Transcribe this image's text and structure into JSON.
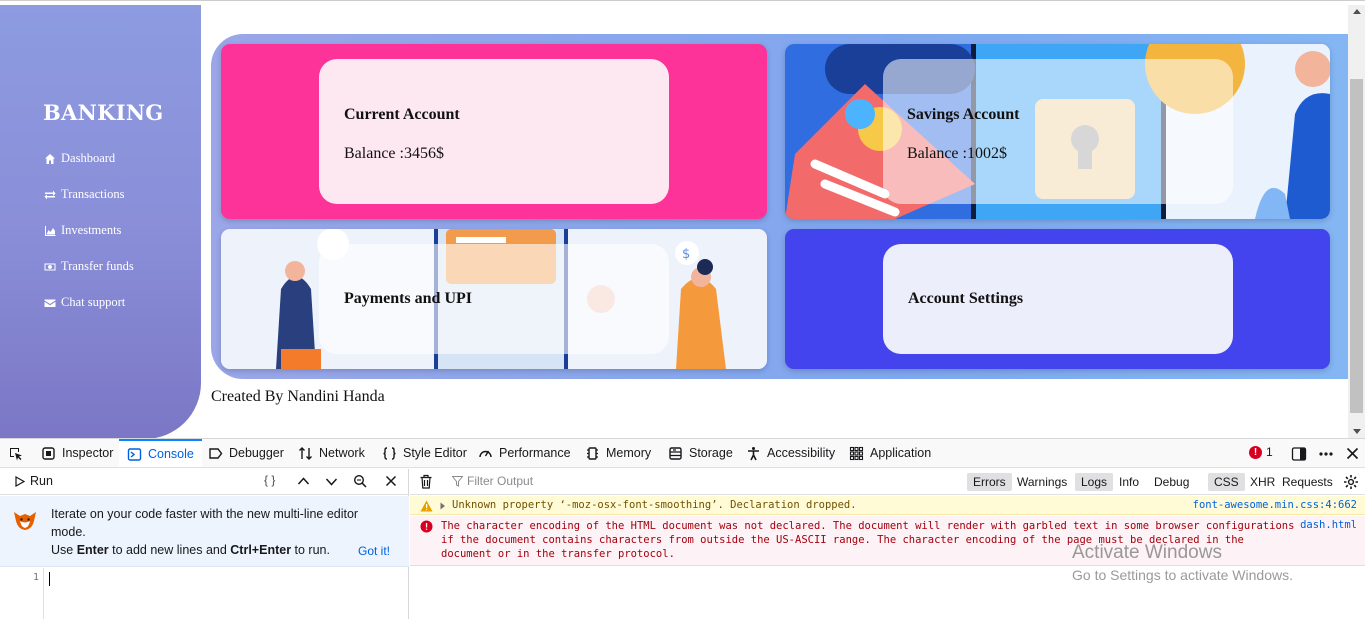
{
  "app": {
    "brand": "BANKING",
    "nav": [
      {
        "label": "Dashboard",
        "icon": "home-icon"
      },
      {
        "label": "Transactions",
        "icon": "exchange-icon"
      },
      {
        "label": "Investments",
        "icon": "area-chart-icon"
      },
      {
        "label": "Transfer funds",
        "icon": "money-icon"
      },
      {
        "label": "Chat support",
        "icon": "envelope-icon"
      }
    ],
    "cards": {
      "current": {
        "title": "Current Account",
        "balance": "Balance :3456$",
        "bg": "#fe3399"
      },
      "savings": {
        "title": "Savings Account",
        "balance": "Balance :1002$"
      },
      "payments": {
        "title": "Payments and UPI"
      },
      "settings": {
        "title": "Account Settings",
        "bg": "#4444ee"
      }
    },
    "credit": "Created By Nandini Handa"
  },
  "devtools": {
    "tabs": [
      {
        "label": "Inspector",
        "icon": "inspector-icon"
      },
      {
        "label": "Console",
        "icon": "console-icon",
        "active": true
      },
      {
        "label": "Debugger",
        "icon": "debugger-icon"
      },
      {
        "label": "Network",
        "icon": "network-icon"
      },
      {
        "label": "Style Editor",
        "icon": "style-editor-icon"
      },
      {
        "label": "Performance",
        "icon": "performance-icon"
      },
      {
        "label": "Memory",
        "icon": "memory-icon"
      },
      {
        "label": "Storage",
        "icon": "storage-icon"
      },
      {
        "label": "Accessibility",
        "icon": "accessibility-icon"
      },
      {
        "label": "Application",
        "icon": "application-icon"
      }
    ],
    "error_count": "1",
    "run_label": "Run",
    "braces_label": "{ }",
    "tip": {
      "line1": "Iterate on your code faster with the new multi-line editor mode.",
      "line2_pre": "Use ",
      "line2_enter": "Enter",
      "line2_mid": " to add new lines and ",
      "line2_ctrl": "Ctrl+Enter",
      "line2_post": " to run.",
      "got_it": "Got it!"
    },
    "editor_line": "1",
    "filter_placeholder": "Filter Output",
    "filters": [
      "Errors",
      "Warnings",
      "Logs",
      "Info",
      "Debug",
      "CSS",
      "XHR",
      "Requests"
    ],
    "filters_on": [
      "Errors",
      "Logs",
      "CSS"
    ],
    "messages": {
      "warning": {
        "text": "Unknown property ‘-moz-osx-font-smoothing’.  Declaration dropped.",
        "source": "font-awesome.min.css:4:662"
      },
      "error": {
        "text": "The character encoding of the HTML document was not declared. The document will render with garbled text in some browser configurations if the document contains characters from outside the US-ASCII range. The character encoding of the page must be declared in the document or in the transfer protocol.",
        "source": "dash.html"
      }
    }
  },
  "watermark": {
    "line1": "Activate Windows",
    "line2": "Go to Settings to activate Windows."
  }
}
